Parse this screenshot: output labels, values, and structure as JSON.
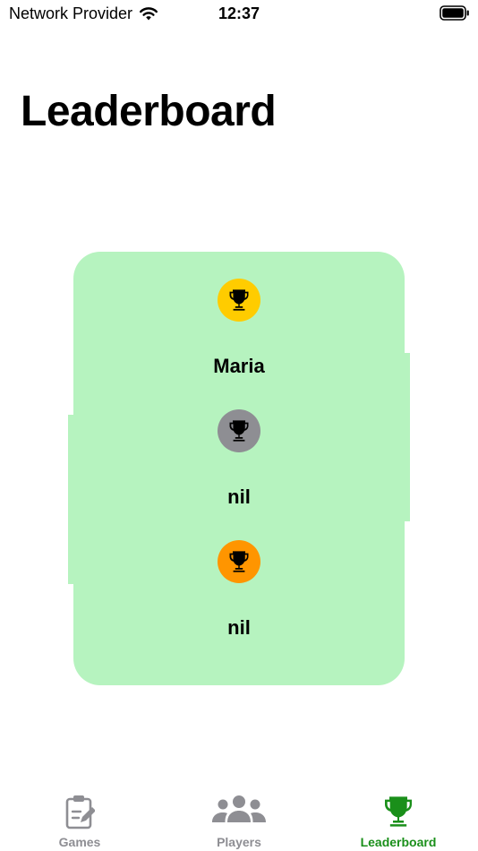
{
  "status_bar": {
    "carrier": "Network Provider",
    "time": "12:37"
  },
  "page": {
    "title": "Leaderboard"
  },
  "podium": {
    "background": "#b6f3bf",
    "ranks": [
      {
        "name": "Maria",
        "color": "#ffcc00",
        "icon": "trophy-icon"
      },
      {
        "name": "nil",
        "color": "#8e8e93",
        "icon": "trophy-icon"
      },
      {
        "name": "nil",
        "color": "#ff9500",
        "icon": "trophy-icon"
      }
    ]
  },
  "tab_bar": {
    "active_color": "#1a8f1a",
    "inactive_color": "#8e8e93",
    "tabs": [
      {
        "label": "Games",
        "icon": "clipboard-icon",
        "active": false
      },
      {
        "label": "Players",
        "icon": "people-icon",
        "active": false
      },
      {
        "label": "Leaderboard",
        "icon": "trophy-icon",
        "active": true
      }
    ]
  }
}
